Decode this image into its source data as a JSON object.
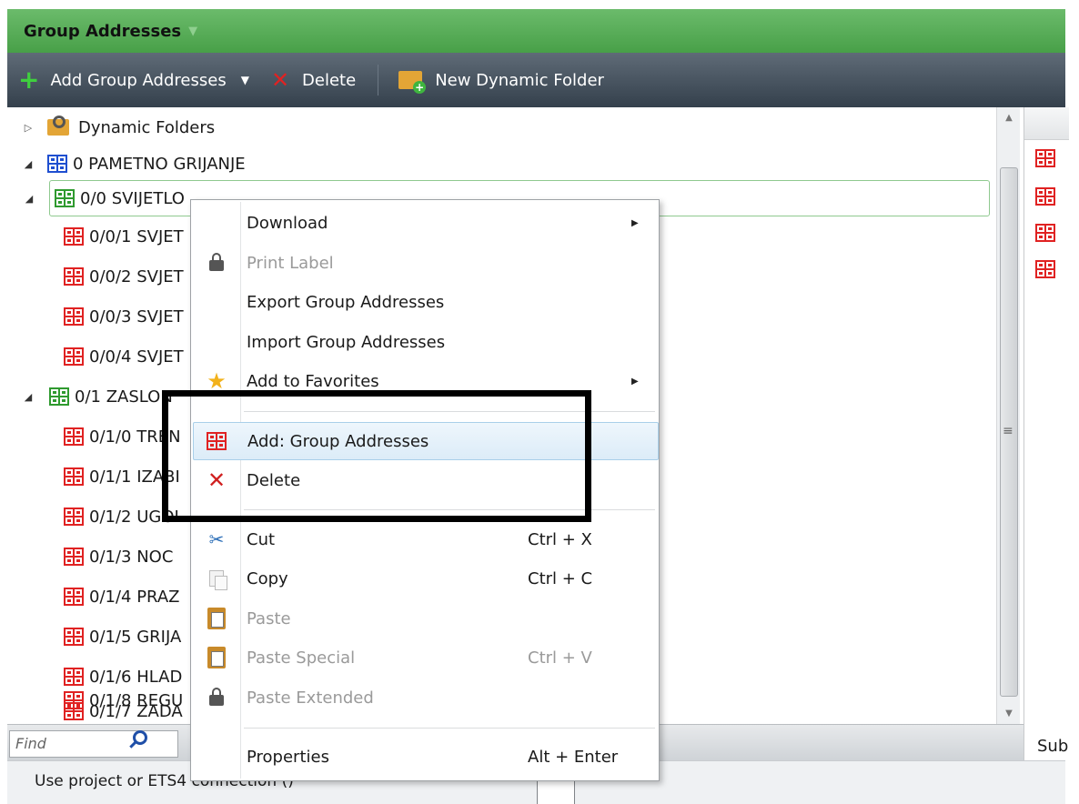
{
  "panel": {
    "title": "Group Addresses",
    "title_caret": "▼"
  },
  "toolbar": {
    "add_label": "Add Group Addresses",
    "add_caret": "▼",
    "delete_label": "Delete",
    "new_folder_label": "New Dynamic Folder"
  },
  "tree": {
    "dynamic_folders": "Dynamic Folders",
    "main_group": "0 PAMETNO GRIJANJE",
    "middle_group_1": "0/0 SVIJETLO",
    "items_1": [
      "0/0/1 SVJET",
      "0/0/2 SVJET",
      "0/0/3 SVJET",
      "0/0/4 SVJET"
    ],
    "middle_group_2": "0/1 ZASLON",
    "items_2": [
      "0/1/0 TREN",
      "0/1/1 IZABI",
      "0/1/2 UGOI",
      "0/1/3 NOC",
      "0/1/4 PRAZ",
      "0/1/5 GRIJA",
      "0/1/6 HLAD",
      "0/1/7 ZADA",
      "0/1/8 REGU"
    ]
  },
  "context_menu": {
    "download": "Download",
    "print_label": "Print Label",
    "export": "Export Group Addresses",
    "import": "Import Group Addresses",
    "favorites": "Add to Favorites",
    "add_ga": "Add: Group Addresses",
    "delete": "Delete",
    "cut": "Cut",
    "cut_shortcut": "Ctrl + X",
    "copy": "Copy",
    "copy_shortcut": "Ctrl + C",
    "paste": "Paste",
    "paste_special": "Paste Special",
    "paste_special_shortcut": "Ctrl + V",
    "paste_extended": "Paste Extended",
    "properties": "Properties",
    "properties_shortcut": "Alt + Enter"
  },
  "find": {
    "placeholder": "Find"
  },
  "right_panel": {
    "sub_label": "Sub"
  },
  "status": {
    "connection_text": "Use project or ETS4 connection ()"
  },
  "colors": {
    "title_green": "#48a048",
    "toolbar_dark": "#34404c",
    "ga_red": "#e02222",
    "ga_green": "#2f9a2f",
    "ga_blue": "#1f4fd0",
    "highlight": "#000000"
  }
}
